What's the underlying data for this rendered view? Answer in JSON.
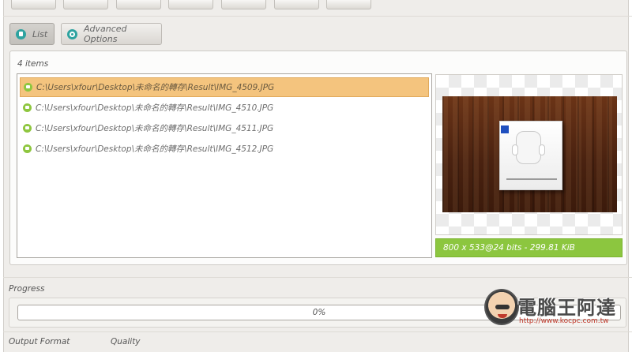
{
  "tabs": [
    {
      "label": "List",
      "icon": "list-icon",
      "active": true
    },
    {
      "label": "Advanced Options",
      "icon": "gear-icon",
      "active": false
    }
  ],
  "file_list": {
    "count_label": "4 items",
    "items": [
      {
        "path": "C:\\Users\\xfour\\Desktop\\未命名的轉存\\Result\\IMG_4509.JPG",
        "selected": true
      },
      {
        "path": "C:\\Users\\xfour\\Desktop\\未命名的轉存\\Result\\IMG_4510.JPG",
        "selected": false
      },
      {
        "path": "C:\\Users\\xfour\\Desktop\\未命名的轉存\\Result\\IMG_4511.JPG",
        "selected": false
      },
      {
        "path": "C:\\Users\\xfour\\Desktop\\未命名的轉存\\Result\\IMG_4512.JPG",
        "selected": false
      }
    ]
  },
  "preview": {
    "info": "800 x 533@24 bits - 299.81 KiB"
  },
  "progress": {
    "label": "Progress",
    "value_text": "0%",
    "fraction": 0
  },
  "bottom_labels": {
    "output_format": "Output Format",
    "quality": "Quality"
  },
  "watermark": {
    "title": "電腦王阿達",
    "url": "http://www.kocpc.com.tw"
  },
  "colors": {
    "selection": "#f4c47e",
    "accent_green": "#8cc63f",
    "tab_icon": "#2ea3a0"
  }
}
